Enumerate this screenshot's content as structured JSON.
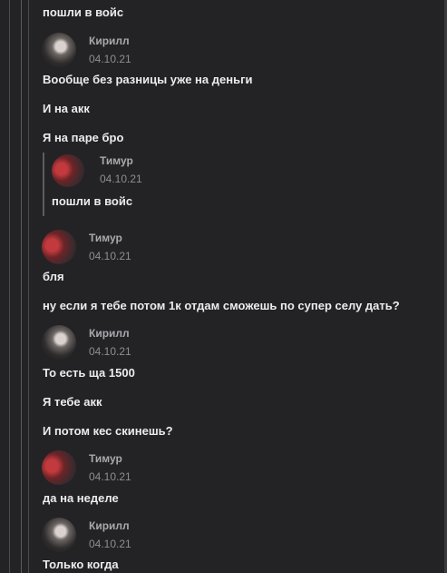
{
  "thread": {
    "m0": "пошли в войс",
    "g1": {
      "name": "Кирилл",
      "date": "04.10.21"
    },
    "m1a": "Вообще без разницы уже на деньги",
    "m1b": "И на акк",
    "m1c": "Я на паре бро",
    "quote": {
      "name": "Тимур",
      "date": "04.10.21",
      "text": "пошли в войс"
    },
    "g2": {
      "name": "Тимур",
      "date": "04.10.21"
    },
    "m2a": "бля",
    "m2b": "ну если я тебе потом 1к отдам сможешь по супер селу дать?",
    "g3": {
      "name": "Кирилл",
      "date": "04.10.21"
    },
    "m3a": "То есть ща 1500",
    "m3b": "Я тебе акк",
    "m3c": "И потом кес скинешь?",
    "g4": {
      "name": "Тимур",
      "date": "04.10.21"
    },
    "m4a": "да на неделе",
    "g5": {
      "name": "Кирилл",
      "date": "04.10.21"
    },
    "m5a": "Только когда"
  }
}
